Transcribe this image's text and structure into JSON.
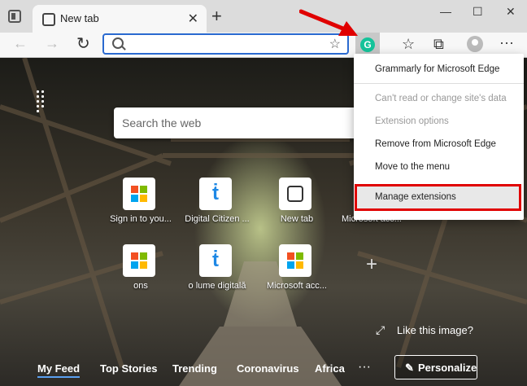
{
  "tab": {
    "title": "New tab",
    "close": "✕"
  },
  "window": {
    "minimize": "—",
    "maximize": "☐",
    "close": "✕"
  },
  "address": {
    "placeholder": ""
  },
  "newtab": {
    "search_placeholder": "Search the web",
    "tiles_row1": [
      {
        "label": "Sign in to you...",
        "icon": "microsoft-icon"
      },
      {
        "label": "Digital Citizen ...",
        "icon": "digital-citizen-icon"
      },
      {
        "label": "New tab",
        "icon": "new-tab-icon"
      },
      {
        "label": "Microsoft acc...",
        "icon": "microsoft-icon"
      }
    ],
    "tiles_row2": [
      {
        "label": "ons",
        "icon": "microsoft-icon"
      },
      {
        "label": "o lume digitală",
        "icon": "digital-citizen-icon"
      },
      {
        "label": "Microsoft acc...",
        "icon": "microsoft-icon"
      }
    ],
    "like_image": "Like this image?",
    "feed": [
      "My Feed",
      "Top Stories",
      "Trending",
      "Coronavirus",
      "Africa"
    ],
    "feed_more": "···",
    "personalize": "Personalize"
  },
  "extension_menu": {
    "items": [
      {
        "label": "Grammarly for Microsoft Edge",
        "enabled": true
      },
      {
        "label": "Can't read or change site's data",
        "enabled": false
      },
      {
        "label": "Extension options",
        "enabled": false
      },
      {
        "label": "Remove from Microsoft Edge",
        "enabled": true
      },
      {
        "label": "Move to the menu",
        "enabled": true
      },
      {
        "label": "Manage extensions",
        "enabled": true,
        "highlighted": true
      }
    ]
  },
  "icons": {
    "grammarly_letter": "G"
  },
  "colors": {
    "accent": "#2a6ad0",
    "grammarly": "#15c39a",
    "highlight": "#e00000"
  }
}
